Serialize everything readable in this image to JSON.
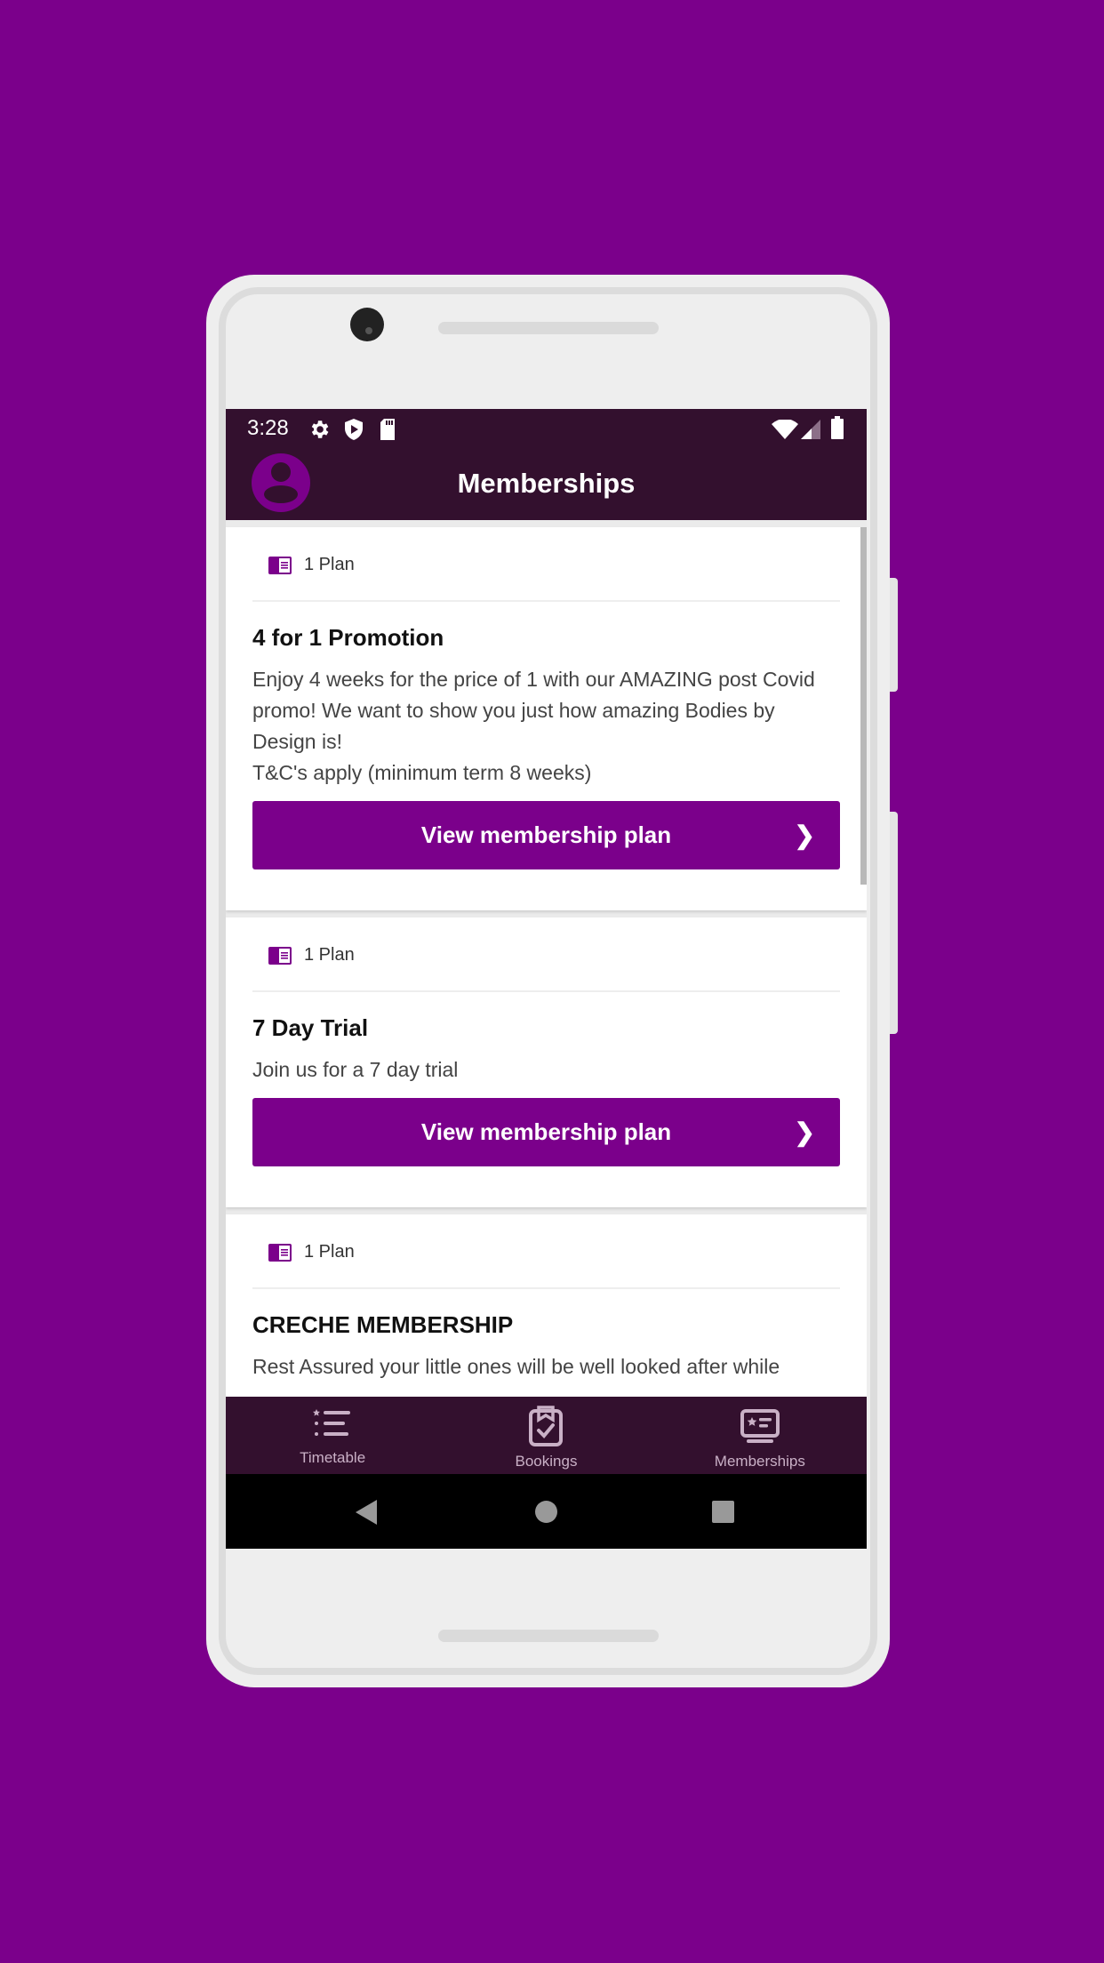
{
  "status_bar": {
    "time": "3:28",
    "left_icons": [
      "settings-icon",
      "shield-play-icon",
      "sd-card-icon"
    ],
    "right_icons": [
      "wifi-icon",
      "signal-icon",
      "battery-icon"
    ]
  },
  "header": {
    "title": "Memberships",
    "avatar_icon": "account-icon"
  },
  "cards": [
    {
      "plan_count": "1 Plan",
      "title": "4 for 1 Promotion",
      "description": "Enjoy 4 weeks for the price of 1 with our AMAZING post Covid promo! We want to show you just how amazing Bodies by Design is!\nT&C's apply (minimum term 8 weeks)",
      "button_label": "View membership plan"
    },
    {
      "plan_count": "1 Plan",
      "title": "7 Day Trial",
      "description": "Join us for a 7 day trial",
      "button_label": "View membership plan"
    },
    {
      "plan_count": "1 Plan",
      "title": "CRECHE MEMBERSHIP",
      "description": "Rest Assured your little ones will be well looked after while"
    }
  ],
  "bottom_nav": {
    "items": [
      {
        "label": "Timetable",
        "icon": "timetable-list-icon"
      },
      {
        "label": "Bookings",
        "icon": "bookings-clipboard-icon"
      },
      {
        "label": "Memberships",
        "icon": "membership-card-icon"
      }
    ]
  },
  "colors": {
    "brand_purple": "#7b008b",
    "header_dark": "#33102e",
    "nav_label": "#c9b0c6"
  }
}
